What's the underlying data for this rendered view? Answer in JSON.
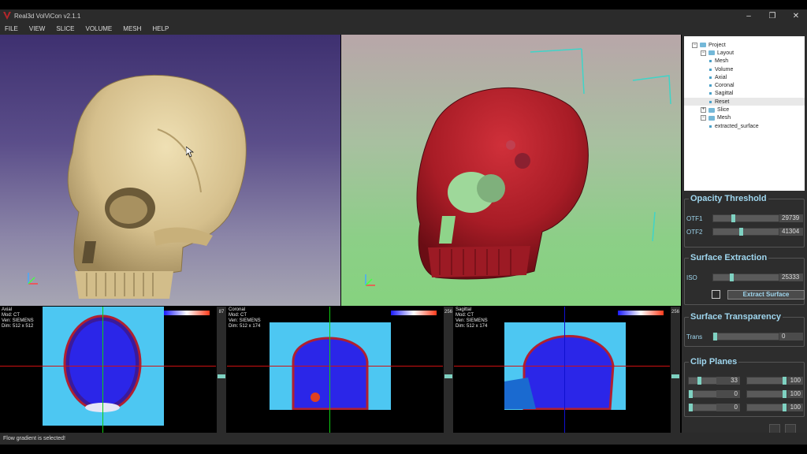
{
  "window": {
    "title": "Real3d VolViCon v2.1.1",
    "controls": [
      "–",
      "❐",
      "✕"
    ]
  },
  "menu": [
    "FILE",
    "VIEW",
    "SLICE",
    "VOLUME",
    "MESH",
    "HELP"
  ],
  "tree": [
    {
      "label": "Project",
      "level": 0,
      "toggle": "−",
      "type": "folder"
    },
    {
      "label": "Layout",
      "level": 1,
      "toggle": "−",
      "type": "folder"
    },
    {
      "label": "Mesh",
      "level": 2,
      "type": "leaf"
    },
    {
      "label": "Volume",
      "level": 2,
      "type": "leaf"
    },
    {
      "label": "Axial",
      "level": 2,
      "type": "leaf"
    },
    {
      "label": "Coronal",
      "level": 2,
      "type": "leaf"
    },
    {
      "label": "Sagittal",
      "level": 2,
      "type": "leaf"
    },
    {
      "label": "Reset",
      "level": 2,
      "type": "leaf",
      "selected": true
    },
    {
      "label": "Slice",
      "level": 1,
      "toggle": "+",
      "type": "folder"
    },
    {
      "label": "Mesh",
      "level": 1,
      "toggle": "−",
      "type": "folder"
    },
    {
      "label": "extracted_surface",
      "level": 2,
      "type": "leaf"
    }
  ],
  "opacity": {
    "title": "Opacity Threshold",
    "otf1_label": "OTF1",
    "otf1_value": "29739",
    "otf1_level": 0.3,
    "otf2_label": "OTF2",
    "otf2_value": "41304",
    "otf2_level": 0.42
  },
  "surface": {
    "title": "Surface Extraction",
    "iso_label": "ISO",
    "iso_value": "25333",
    "iso_level": 0.27,
    "extract_label": "Extract Surface"
  },
  "transparency": {
    "title": "Surface Transparency",
    "trans_label": "Trans",
    "trans_value": "0",
    "trans_level": 0.0
  },
  "clip": {
    "title": "Clip Planes",
    "rows": [
      {
        "left_value": "33",
        "left_level": 0.33,
        "right_value": "100",
        "right_level": 1.0
      },
      {
        "left_value": "0",
        "left_level": 0.0,
        "right_value": "100",
        "right_level": 1.0
      },
      {
        "left_value": "0",
        "left_level": 0.0,
        "right_value": "100",
        "right_level": 1.0
      }
    ]
  },
  "slices": {
    "axial": {
      "info": "Axial\nMod: CT\nVen: SIEMENS\nDim: 512 x 512",
      "index": "87"
    },
    "coronal": {
      "info": "Coronal\nMod: CT\nVen: SIEMENS\nDim: 512 x 174",
      "index": "256"
    },
    "sagittal": {
      "info": "Sagittal\nMod: CT\nVen: SIEMENS\nDim: 512 x 174",
      "index": "256"
    }
  },
  "status": "Flow gradient is selected!",
  "colors": {
    "accent": "#9fd6ee",
    "slider_thumb": "#7fd2c2",
    "skull_bone": "#d8c290",
    "skull_red": "#b0202a",
    "slice_background": "#4dc7f2"
  }
}
